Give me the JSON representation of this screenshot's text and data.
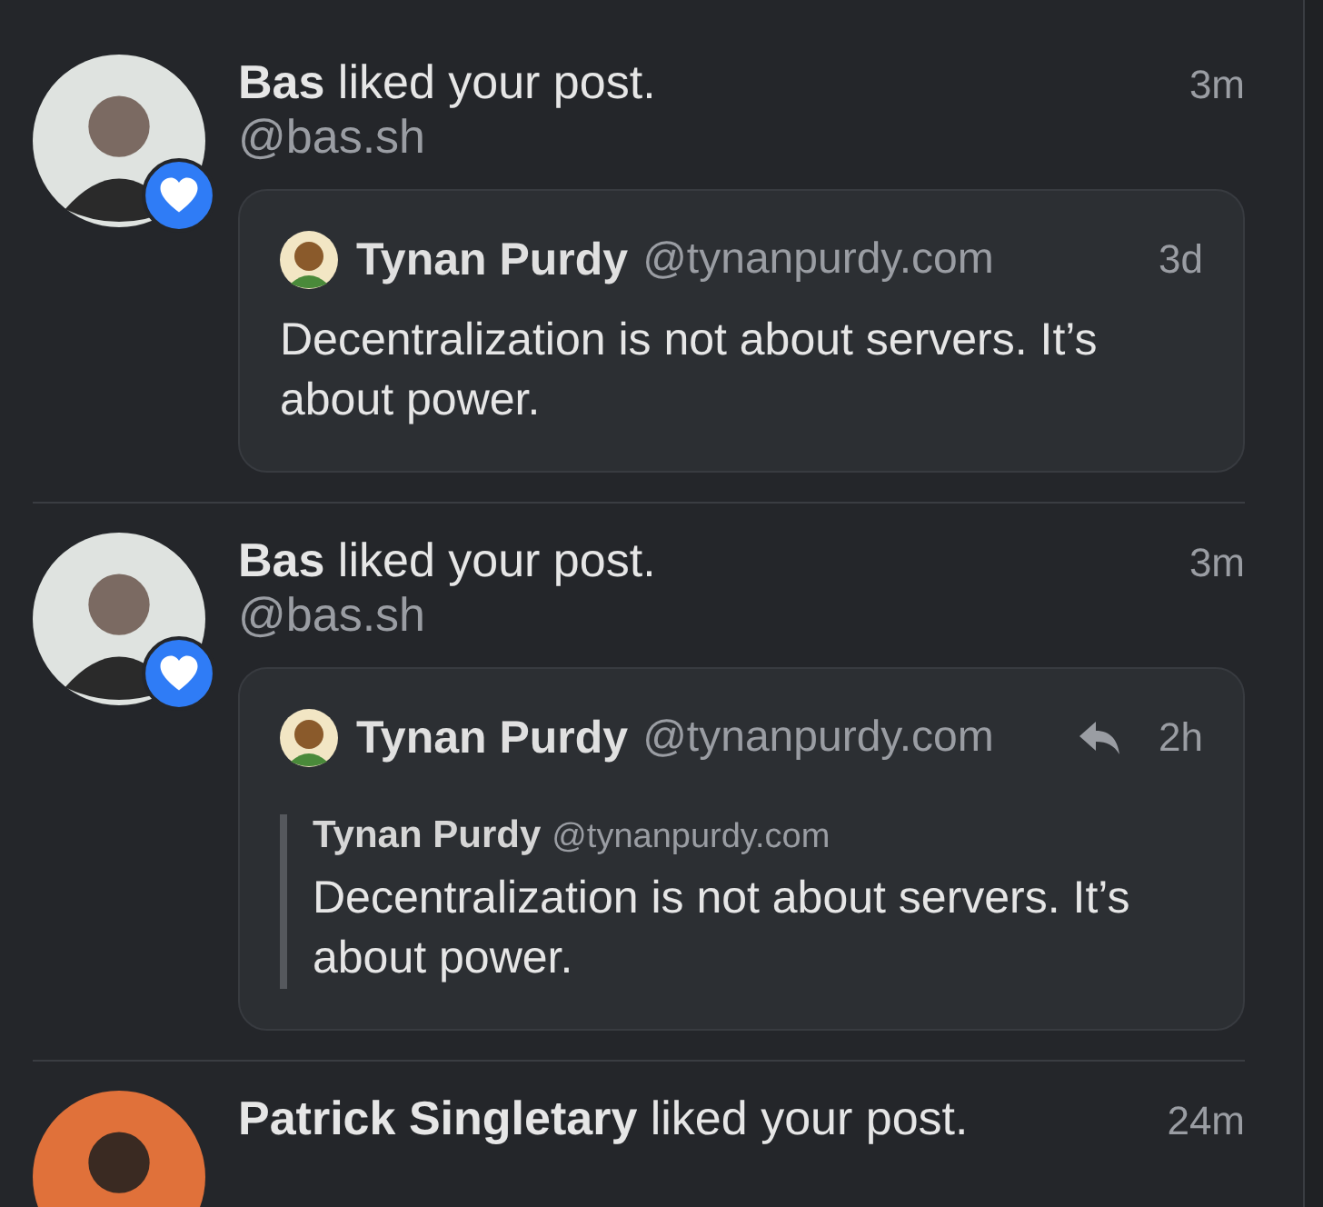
{
  "notifications": [
    {
      "title": "**Bas** liked your post.",
      "handle": "@bas.sh",
      "time": "3m",
      "badge": {
        "kind": "like"
      },
      "post": {
        "author": "Tynan Purdy",
        "handle": "@tynanpurdy.com",
        "time": "3d",
        "is_reply": false,
        "text": "Decentralization is not about servers. It’s about power."
      }
    },
    {
      "title": "**Bas** liked your post.",
      "handle": "@bas.sh",
      "time": "3m",
      "badge": {
        "kind": "like"
      },
      "post": {
        "author": "Tynan Purdy",
        "handle": "@tynanpurdy.com",
        "time": "2h",
        "is_reply": true,
        "quote": {
          "author": "Tynan Purdy",
          "handle": "@tynanpurdy.com",
          "text": "Decentralization is not about servers. It’s about power."
        }
      }
    },
    {
      "title": "**Patrick Singletary** liked your post.",
      "time": "24m"
    }
  ]
}
